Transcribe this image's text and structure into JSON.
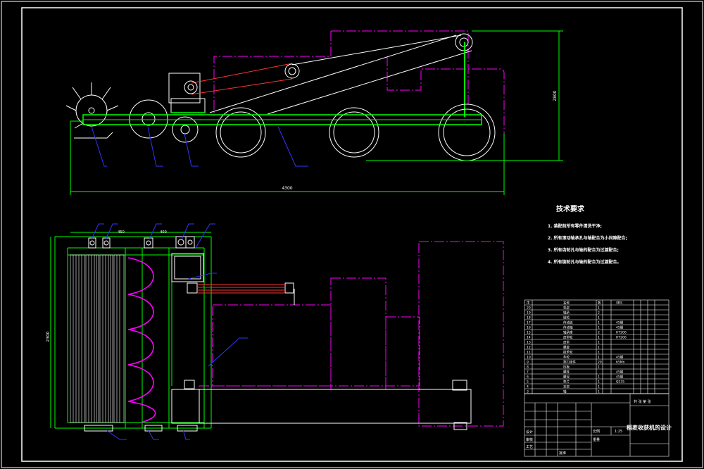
{
  "dimensions": {
    "overall_length": "4300",
    "overall_height": "2800",
    "plan_width": "2300",
    "plan_short": "450",
    "plan_mid": "400"
  },
  "tech_notes": {
    "title": "技术要求",
    "items": [
      "1. 装配前所有零件清洗干净;",
      "2. 所有滚动轴承孔与轴配合为小间隙配合;",
      "3. 所有齿轮孔与轴的配合为过渡配合;",
      "4. 所有链轮孔与轴的配合为过渡配合。"
    ]
  },
  "bom": {
    "header": {
      "no": "序",
      "name": "名称",
      "qty": "数",
      "material": "材料"
    },
    "rows": [
      {
        "no": "20",
        "name": "机架",
        "qty": "1",
        "material": ""
      },
      {
        "no": "19",
        "name": "轴承",
        "qty": "2",
        "material": ""
      },
      {
        "no": "18",
        "name": "链轮",
        "qty": "1",
        "material": ""
      },
      {
        "no": "17",
        "name": "传动链",
        "qty": "1",
        "material": "45钢"
      },
      {
        "no": "16",
        "name": "传动轴",
        "qty": "1",
        "material": "45钢"
      },
      {
        "no": "15",
        "name": "轴承座",
        "qty": "2",
        "material": "HT200"
      },
      {
        "no": "14",
        "name": "皮带轮",
        "qty": "1",
        "material": "HT200"
      },
      {
        "no": "13",
        "name": "皮带",
        "qty": "1",
        "material": ""
      },
      {
        "no": "12",
        "name": "螺旋",
        "qty": "1",
        "material": ""
      },
      {
        "no": "11",
        "name": "拨禾轮",
        "qty": "1",
        "material": ""
      },
      {
        "no": "10",
        "name": "车轮",
        "qty": "1",
        "material": "45钢"
      },
      {
        "no": "9",
        "name": "割刀组件",
        "qty": "20",
        "material": "65Mn"
      },
      {
        "no": "8",
        "name": "压板",
        "qty": "1",
        "material": ""
      },
      {
        "no": "7",
        "name": "螺栓",
        "qty": "",
        "material": "45钢"
      },
      {
        "no": "6",
        "name": "螺母",
        "qty": "1",
        "material": "45钢"
      },
      {
        "no": "5",
        "name": "垫片",
        "qty": "1",
        "material": "Q235"
      },
      {
        "no": "4",
        "name": "支架",
        "qty": "1",
        "material": ""
      },
      {
        "no": "3",
        "name": "轴",
        "qty": "1",
        "material": ""
      }
    ]
  },
  "title_block": {
    "drawing_title": "稻麦收获机的设计",
    "scale_label": "比例",
    "scale": "1:25",
    "weight_label": "重量",
    "sheet_label": "共 张 第 张",
    "designer_label": "设计",
    "checker_label": "审核",
    "approver_label": "批准",
    "process_label": "工艺"
  }
}
